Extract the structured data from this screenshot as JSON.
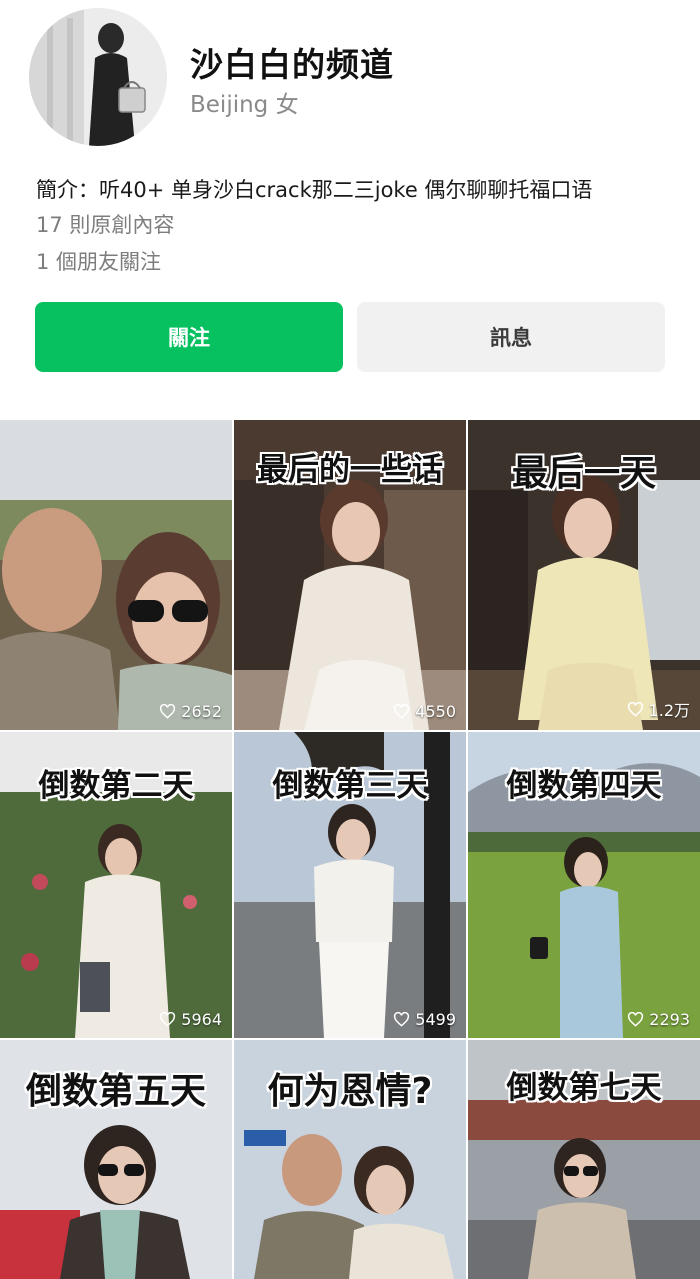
{
  "profile": {
    "name": "沙白白的频道",
    "location": "Beijing 女",
    "bio": "簡介：听40+ 单身沙白crack那二三joke 偶尔聊聊托福口语",
    "original_content": "17 則原創內容",
    "friends_following": "1 個朋友關注"
  },
  "actions": {
    "follow_label": "關注",
    "message_label": "訊息"
  },
  "colors": {
    "follow_button": "#07c160",
    "message_button": "#f1f1f1"
  },
  "videos": [
    {
      "caption": "",
      "likes": "2652"
    },
    {
      "caption": "最后的一些话",
      "likes": "4550"
    },
    {
      "caption": "最后一天",
      "likes": "1.2万"
    },
    {
      "caption": "倒数第二天",
      "likes": "5964"
    },
    {
      "caption": "倒数第三天",
      "likes": "5499"
    },
    {
      "caption": "倒数第四天",
      "likes": "2293"
    },
    {
      "caption": "倒数第五天",
      "likes": ""
    },
    {
      "caption": "何为恩情?",
      "likes": ""
    },
    {
      "caption": "倒数第七天",
      "likes": ""
    }
  ]
}
